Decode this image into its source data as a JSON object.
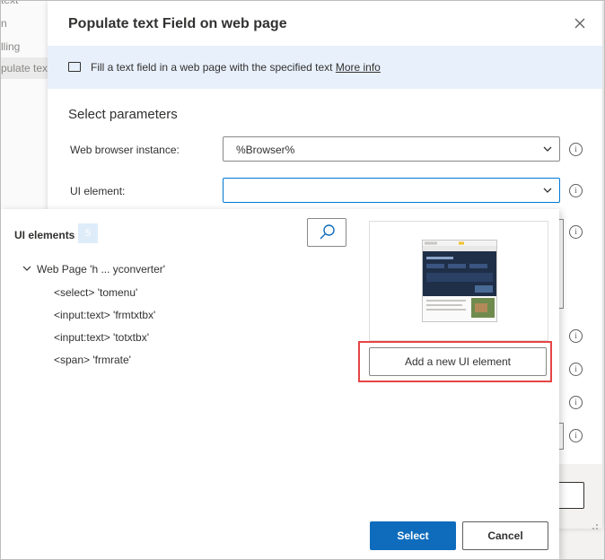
{
  "background_sidebar": {
    "items": [
      "text",
      "n",
      "lling",
      "pulate text"
    ]
  },
  "dialog": {
    "title": "Populate text Field on web page",
    "info_text": "Fill a text field in a web page with the specified text",
    "info_link": "More info",
    "section_title": "Select parameters",
    "fields": [
      {
        "label": "Web browser instance:",
        "value": "%Browser%"
      },
      {
        "label": "UI element:",
        "value": ""
      }
    ]
  },
  "picker": {
    "title": "UI elements",
    "count": "5",
    "root": "Web Page 'h ... yconverter'",
    "items": [
      "<select> 'tomenu'",
      "<input:text> 'frmtxtbx'",
      "<input:text> 'totxtbx'",
      "<span> 'frmrate'"
    ],
    "add_button": "Add a new UI element",
    "select_button": "Select",
    "cancel_button": "Cancel"
  },
  "colors": {
    "accent": "#0f6cbd",
    "focus_border": "#0078d4",
    "highlight": "#e64545",
    "info_bar": "#e8f0fb"
  }
}
